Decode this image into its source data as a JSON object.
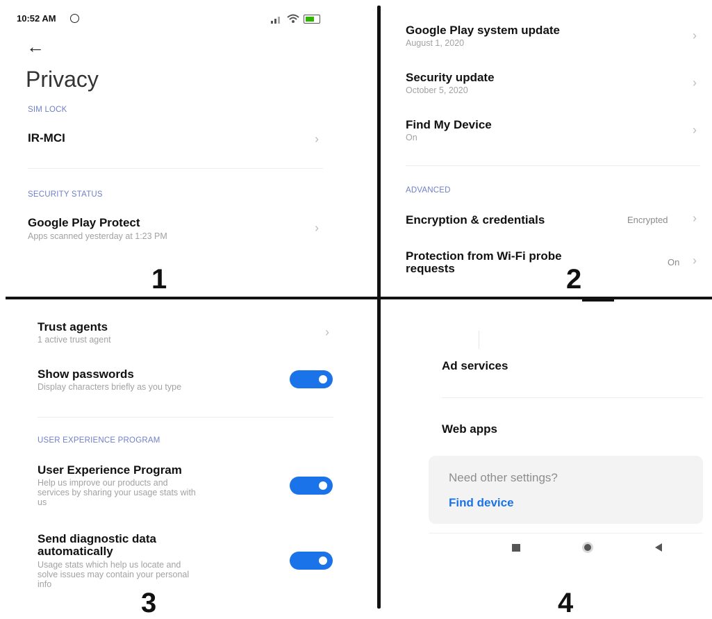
{
  "status_bar": {
    "time": "10:52 AM"
  },
  "panel1": {
    "page_title": "Privacy",
    "sim_lock_header": "SIM LOCK",
    "sim_lock_item": "IR-MCI",
    "security_status_header": "SECURITY STATUS",
    "play_protect": {
      "title": "Google Play Protect",
      "subtitle": "Apps scanned yesterday at 1:23 PM"
    },
    "number": "1"
  },
  "panel2": {
    "play_system_update": {
      "title": "Google Play system update",
      "subtitle": "August 1, 2020"
    },
    "security_update": {
      "title": "Security update",
      "subtitle": "October 5, 2020"
    },
    "find_my_device": {
      "title": "Find My Device",
      "subtitle": "On"
    },
    "advanced_header": "ADVANCED",
    "encryption": {
      "title": "Encryption & credentials",
      "value": "Encrypted"
    },
    "wifi_probe": {
      "title_line1": "Protection from Wi-Fi probe",
      "title_line2": "requests",
      "value": "On"
    },
    "number": "2"
  },
  "panel3": {
    "trust_agents": {
      "title": "Trust agents",
      "subtitle": "1 active trust agent"
    },
    "show_passwords": {
      "title": "Show passwords",
      "subtitle": "Display characters briefly as you type",
      "enabled": true
    },
    "uxp_header": "USER EXPERIENCE PROGRAM",
    "uxp": {
      "title": "User Experience Program",
      "desc_line1": "Help us improve our products and",
      "desc_line2": "services by sharing your usage stats with",
      "desc_line3": "us",
      "enabled": true
    },
    "diag": {
      "title_line1": "Send diagnostic data",
      "title_line2": "automatically",
      "desc_line1": "Usage stats which help us locate and",
      "desc_line2": "solve issues may contain your personal",
      "desc_line3": "info",
      "enabled": true
    },
    "number": "3"
  },
  "panel4": {
    "ad_services": "Ad services",
    "web_apps": "Web apps",
    "need_other": "Need other settings?",
    "find_device_link": "Find device",
    "number": "4"
  },
  "colors": {
    "accent": "#1a73e8",
    "section_header": "#6f7fc9",
    "subtitle": "#a2a2a2"
  }
}
